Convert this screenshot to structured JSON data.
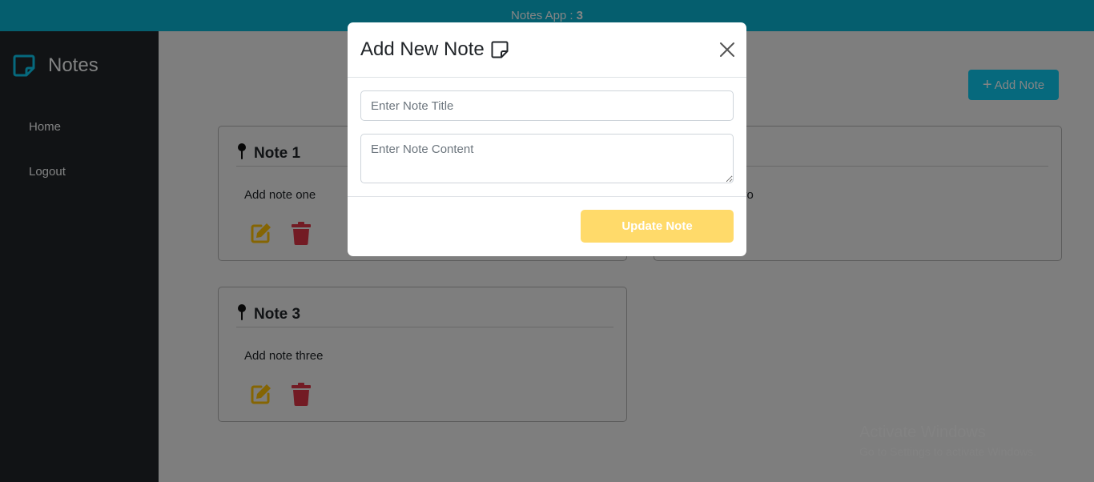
{
  "topbar": {
    "title": "Notes App :",
    "count": "3"
  },
  "sidebar": {
    "brand": "Notes",
    "items": [
      {
        "label": "Home"
      },
      {
        "label": "Logout"
      }
    ]
  },
  "main": {
    "add_button": "Add Note",
    "notes": [
      {
        "title": "Note 1",
        "content": "Add note one"
      },
      {
        "title": "",
        "content": "vo"
      },
      {
        "title": "Note 3",
        "content": "Add note three"
      }
    ]
  },
  "modal": {
    "title": "Add New Note",
    "title_placeholder": "Enter Note Title",
    "content_placeholder": "Enter Note Content",
    "submit": "Update Note"
  },
  "watermark": {
    "title": "Activate Windows",
    "subtitle": "Go to Settings to activate Windows."
  },
  "colors": {
    "topbar": "#0bb4d4",
    "sidebar": "#212529",
    "accent": "#0dcaf0",
    "edit_icon": "#ffc107",
    "delete_icon": "#dc3545",
    "update_button": "#ffda6a"
  },
  "icons": [
    "sticky-note-icon",
    "plus-icon",
    "pin-icon",
    "edit-icon",
    "trash-icon",
    "close-icon"
  ]
}
